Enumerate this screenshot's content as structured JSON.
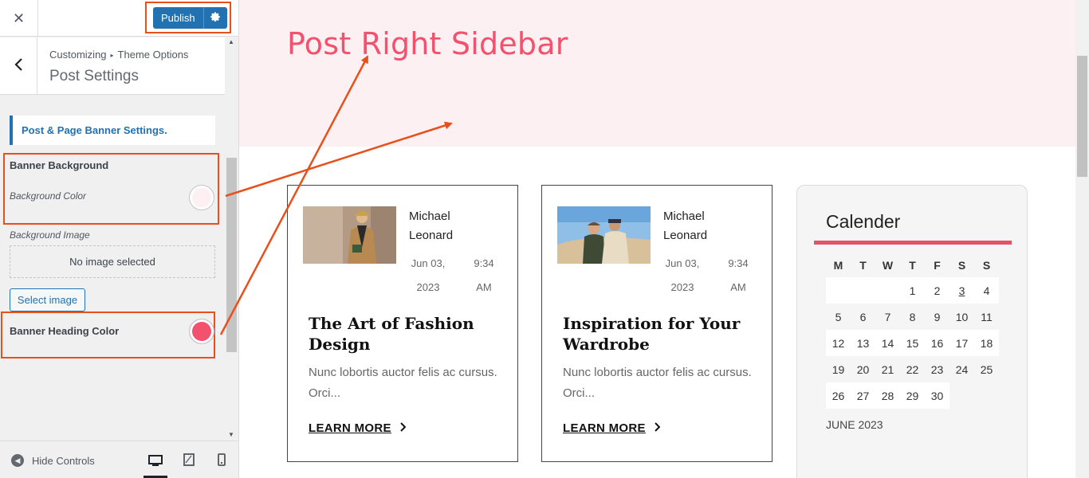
{
  "panel": {
    "close_label": "✕",
    "publish_label": "Publish",
    "breadcrumb": [
      "Customizing",
      "Theme Options"
    ],
    "section_title": "Post Settings",
    "group_title": "Post & Page Banner Settings.",
    "banner_background": {
      "label": "Banner Background",
      "sub_label": "Background Color",
      "color": "#fdf0f2"
    },
    "background_image": {
      "label": "Background Image",
      "empty_text": "No image selected",
      "button_label": "Select image"
    },
    "banner_heading_color": {
      "label": "Banner Heading Color",
      "color": "#f2526e"
    },
    "footer": {
      "hide_controls_label": "Hide Controls",
      "devices": [
        "desktop-icon",
        "tablet-icon",
        "mobile-icon"
      ]
    }
  },
  "preview": {
    "banner_title": "Post Right Sidebar",
    "banner_bg": "#fdf0f2",
    "banner_title_color": "#f2526e",
    "posts": [
      {
        "author": "Michael Leonard",
        "date": "Jun 03, 2023",
        "time": "9:34 AM",
        "title": "The Art of Fashion Design",
        "excerpt": "Nunc lobortis auctor felis ac cursus. Orci...",
        "link": "LEARN MORE"
      },
      {
        "author": "Michael Leonard",
        "date": "Jun 03, 2023",
        "time": "9:34 AM",
        "title": "Inspiration for Your Wardrobe",
        "excerpt": "Nunc lobortis auctor felis ac cursus. Orci...",
        "link": "LEARN MORE"
      }
    ],
    "calendar": {
      "title": "Calender",
      "weekdays": [
        "M",
        "T",
        "W",
        "T",
        "F",
        "S",
        "S"
      ],
      "weeks": [
        [
          "",
          "",
          "",
          "1",
          "2",
          "3",
          "4"
        ],
        [
          "5",
          "6",
          "7",
          "8",
          "9",
          "10",
          "11"
        ],
        [
          "12",
          "13",
          "14",
          "15",
          "16",
          "17",
          "18"
        ],
        [
          "19",
          "20",
          "21",
          "22",
          "23",
          "24",
          "25"
        ],
        [
          "26",
          "27",
          "28",
          "29",
          "30",
          "",
          ""
        ]
      ],
      "today": "3",
      "month_label": "JUNE 2023"
    }
  },
  "colors": {
    "accent": "#2271b1",
    "annotation": "#e8501b",
    "calendar_bar": "#e2536a"
  }
}
